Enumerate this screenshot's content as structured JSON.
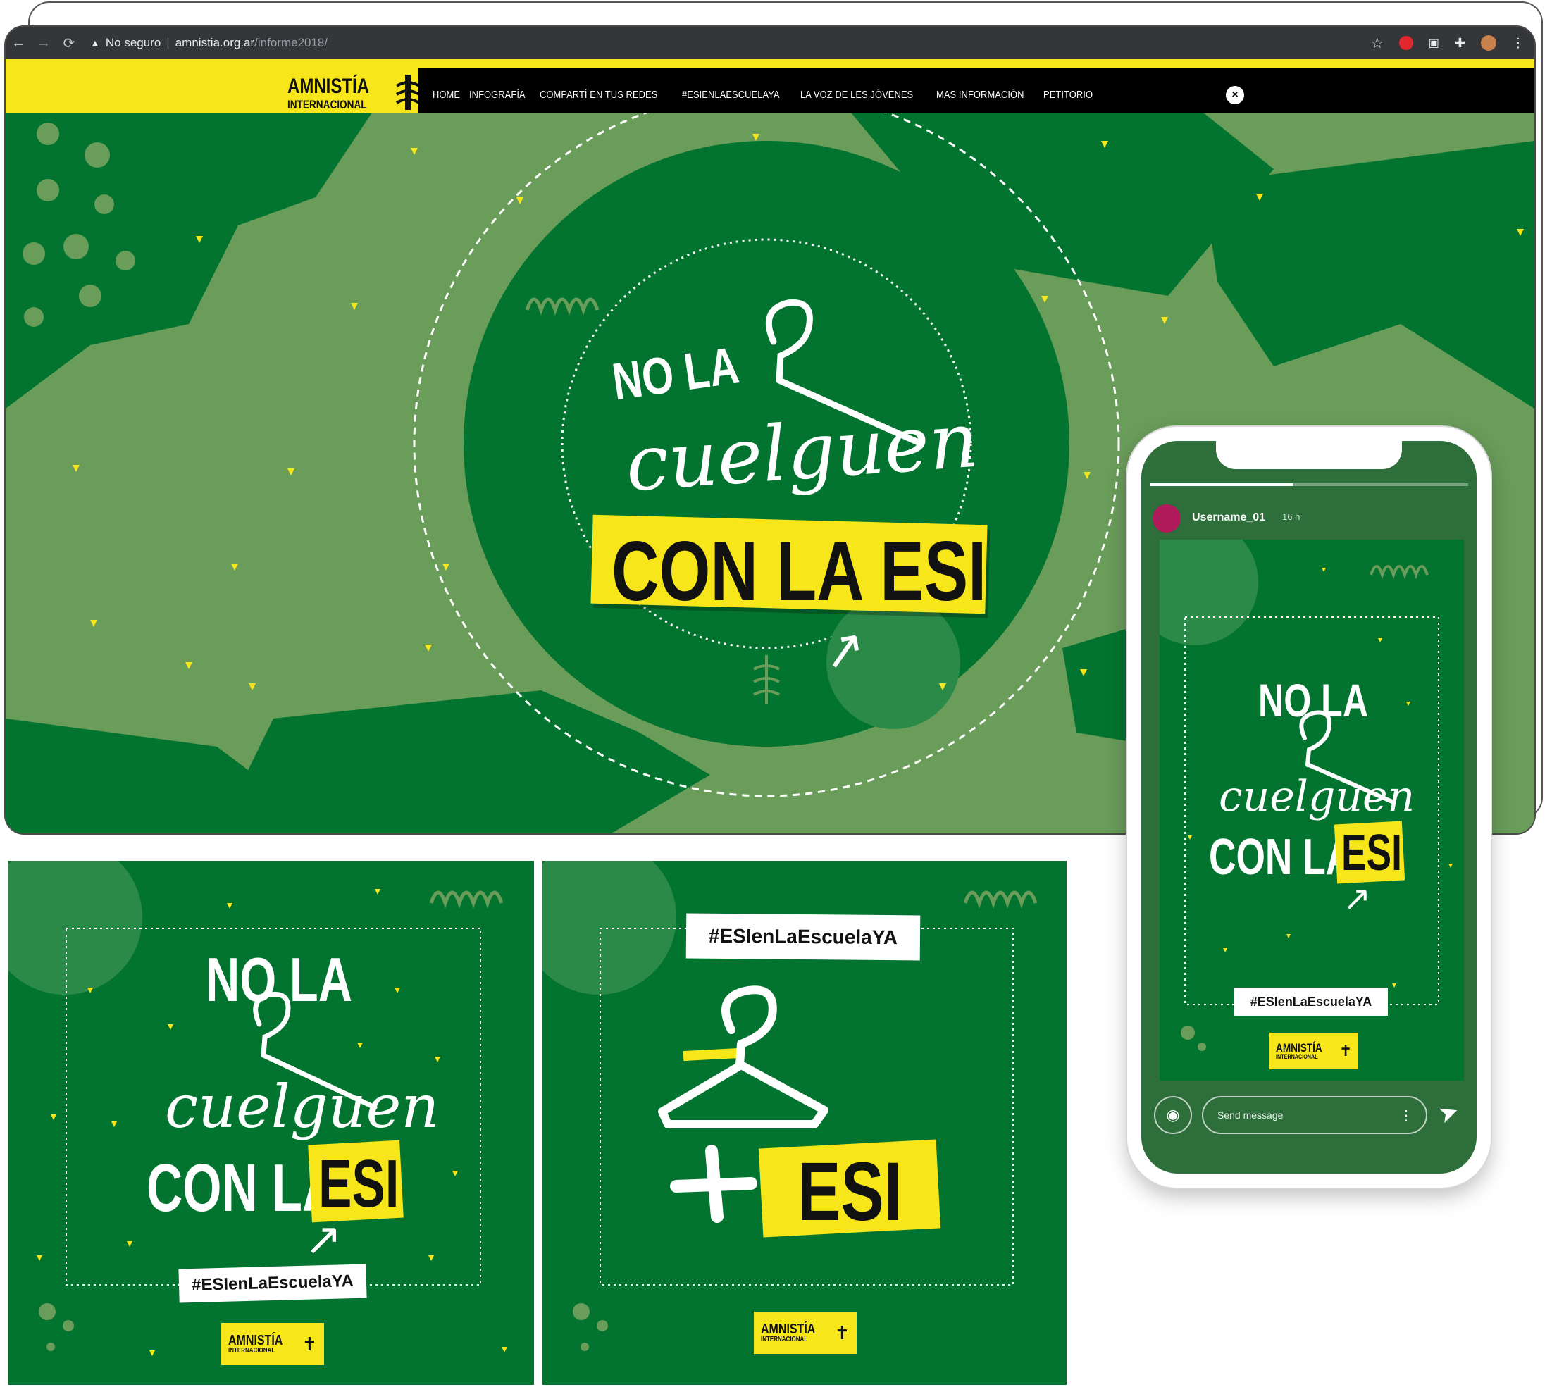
{
  "browser": {
    "security_label": "No seguro",
    "url_host": "amnistia.org.ar",
    "url_path": "/informe2018/"
  },
  "site": {
    "logo_line1": "AMNISTÍA",
    "logo_line2": "INTERNACIONAL",
    "nav": [
      "HOME",
      "INFOGRAFÍA",
      "COMPARTÍ EN TUS REDES",
      "#ESIENLAESCUELAYA",
      "LA VOZ DE LES JÓVENES",
      "MAS INFORMACIÓN",
      "PETITORIO"
    ]
  },
  "campaign": {
    "line1": "NO LA",
    "script": "cuelguen",
    "line2": "CON LA ESI",
    "line2_a": "CON LA",
    "esi": "ESI",
    "hashtag": "#ESIenLaEscuelaYA"
  },
  "phone": {
    "username": "Username_01",
    "time": "16 h",
    "message_placeholder": "Send message"
  },
  "colors": {
    "yellow": "#f7e61a",
    "dark_green": "#03742f",
    "light_green": "#6a9c5a"
  }
}
